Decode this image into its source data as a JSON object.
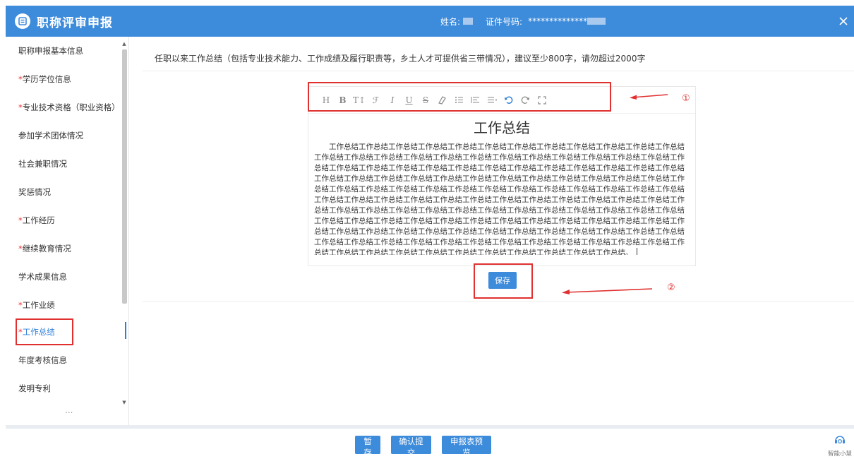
{
  "header": {
    "title": "职称评审申报",
    "name_label": "姓名:",
    "id_label": "证件号码:",
    "id_value": "**************"
  },
  "sidebar": {
    "items": [
      {
        "label": "职称申报基本信息",
        "required": false
      },
      {
        "label": "学历学位信息",
        "required": true
      },
      {
        "label": "专业技术资格（职业资格）",
        "required": true
      },
      {
        "label": "参加学术团体情况",
        "required": false
      },
      {
        "label": "社会兼职情况",
        "required": false
      },
      {
        "label": "奖惩情况",
        "required": false
      },
      {
        "label": "工作经历",
        "required": true
      },
      {
        "label": "继续教育情况",
        "required": true
      },
      {
        "label": "学术成果信息",
        "required": false
      },
      {
        "label": "工作业绩",
        "required": true
      },
      {
        "label": "工作总结",
        "required": true,
        "active": true
      },
      {
        "label": "年度考核信息",
        "required": false
      },
      {
        "label": "发明专利",
        "required": false
      }
    ],
    "more": "...",
    "required_mark": "*"
  },
  "main": {
    "instruction": "任职以来工作总结（包括专业技术能力、工作成绩及履行职责等，乡土人才可提供省三带情况），建议至少800字，请勿超过2000字"
  },
  "editor": {
    "toolbar": [
      {
        "icon": "heading-icon",
        "glyph": "H"
      },
      {
        "icon": "bold-icon",
        "glyph": "B"
      },
      {
        "icon": "font-size-icon",
        "glyph": "T↕"
      },
      {
        "icon": "font-family-icon",
        "glyph": "ℱ"
      },
      {
        "icon": "italic-icon",
        "glyph": "I"
      },
      {
        "icon": "underline-icon",
        "glyph": "U"
      },
      {
        "icon": "strikethrough-icon",
        "glyph": "S"
      },
      {
        "icon": "eraser-icon",
        "glyph": ""
      },
      {
        "icon": "list-icon",
        "glyph": ""
      },
      {
        "icon": "align-left-icon",
        "glyph": ""
      },
      {
        "icon": "align-justify-icon",
        "glyph": ""
      },
      {
        "icon": "undo-icon",
        "glyph": ""
      },
      {
        "icon": "redo-icon",
        "glyph": ""
      },
      {
        "icon": "fullscreen-icon",
        "glyph": ""
      }
    ],
    "doc_title": "工作总结",
    "doc_body": "工作总结工作总结工作总结工作总结工作总结工作总结工作总结工作总结工作总结工作总结工作总结工作总结工作总结工作总结工作总结工作总结工作总结工作总结工作总结工作总结工作总结工作总结工作总结工作总结工作总结工作总结工作总结工作总结工作总结工作总结工作总结工作总结工作总结工作总结工作总结工作总结工作总结工作总结工作总结工作总结工作总结工作总结工作总结工作总结工作总结工作总结工作总结工作总结工作总结工作总结工作总结工作总结工作总结工作总结工作总结工作总结工作总结工作总结工作总结工作总结工作总结工作总结工作总结工作总结工作总结工作总结工作总结工作总结工作总结工作总结工作总结工作总结工作总结工作总结工作总结工作总结工作总结工作总结工作总结工作总结工作总结工作总结工作总结工作总结工作总结工作总结工作总结工作总结工作总结工作总结工作总结工作总结工作总结工作总结工作总结工作总结工作总结工作总结工作总结工作总结工作总结工作总结工作总结工作总结工作总结工作总结工作总结工作总结工作总结工作总结工作总结工作总结工作总结工作总结工作总结工作总结工作总结工作总结工作总结工作总结工作总结工作总结工作总结工作总结工作总结工作总结工作总结工作总结工作总结工作总结工作总结工作总结工作总结工作总结工作总结。",
    "save_label": "保存"
  },
  "annotations": {
    "marker_1": "①",
    "marker_2": "②"
  },
  "footer": {
    "temp_save": "暂存",
    "confirm_submit": "确认提交",
    "preview": "申报表预览",
    "assistant": "智能小慧"
  },
  "colors": {
    "primary": "#3d8bdb",
    "highlight": "#e03030",
    "active_text": "#2f7fd8"
  }
}
